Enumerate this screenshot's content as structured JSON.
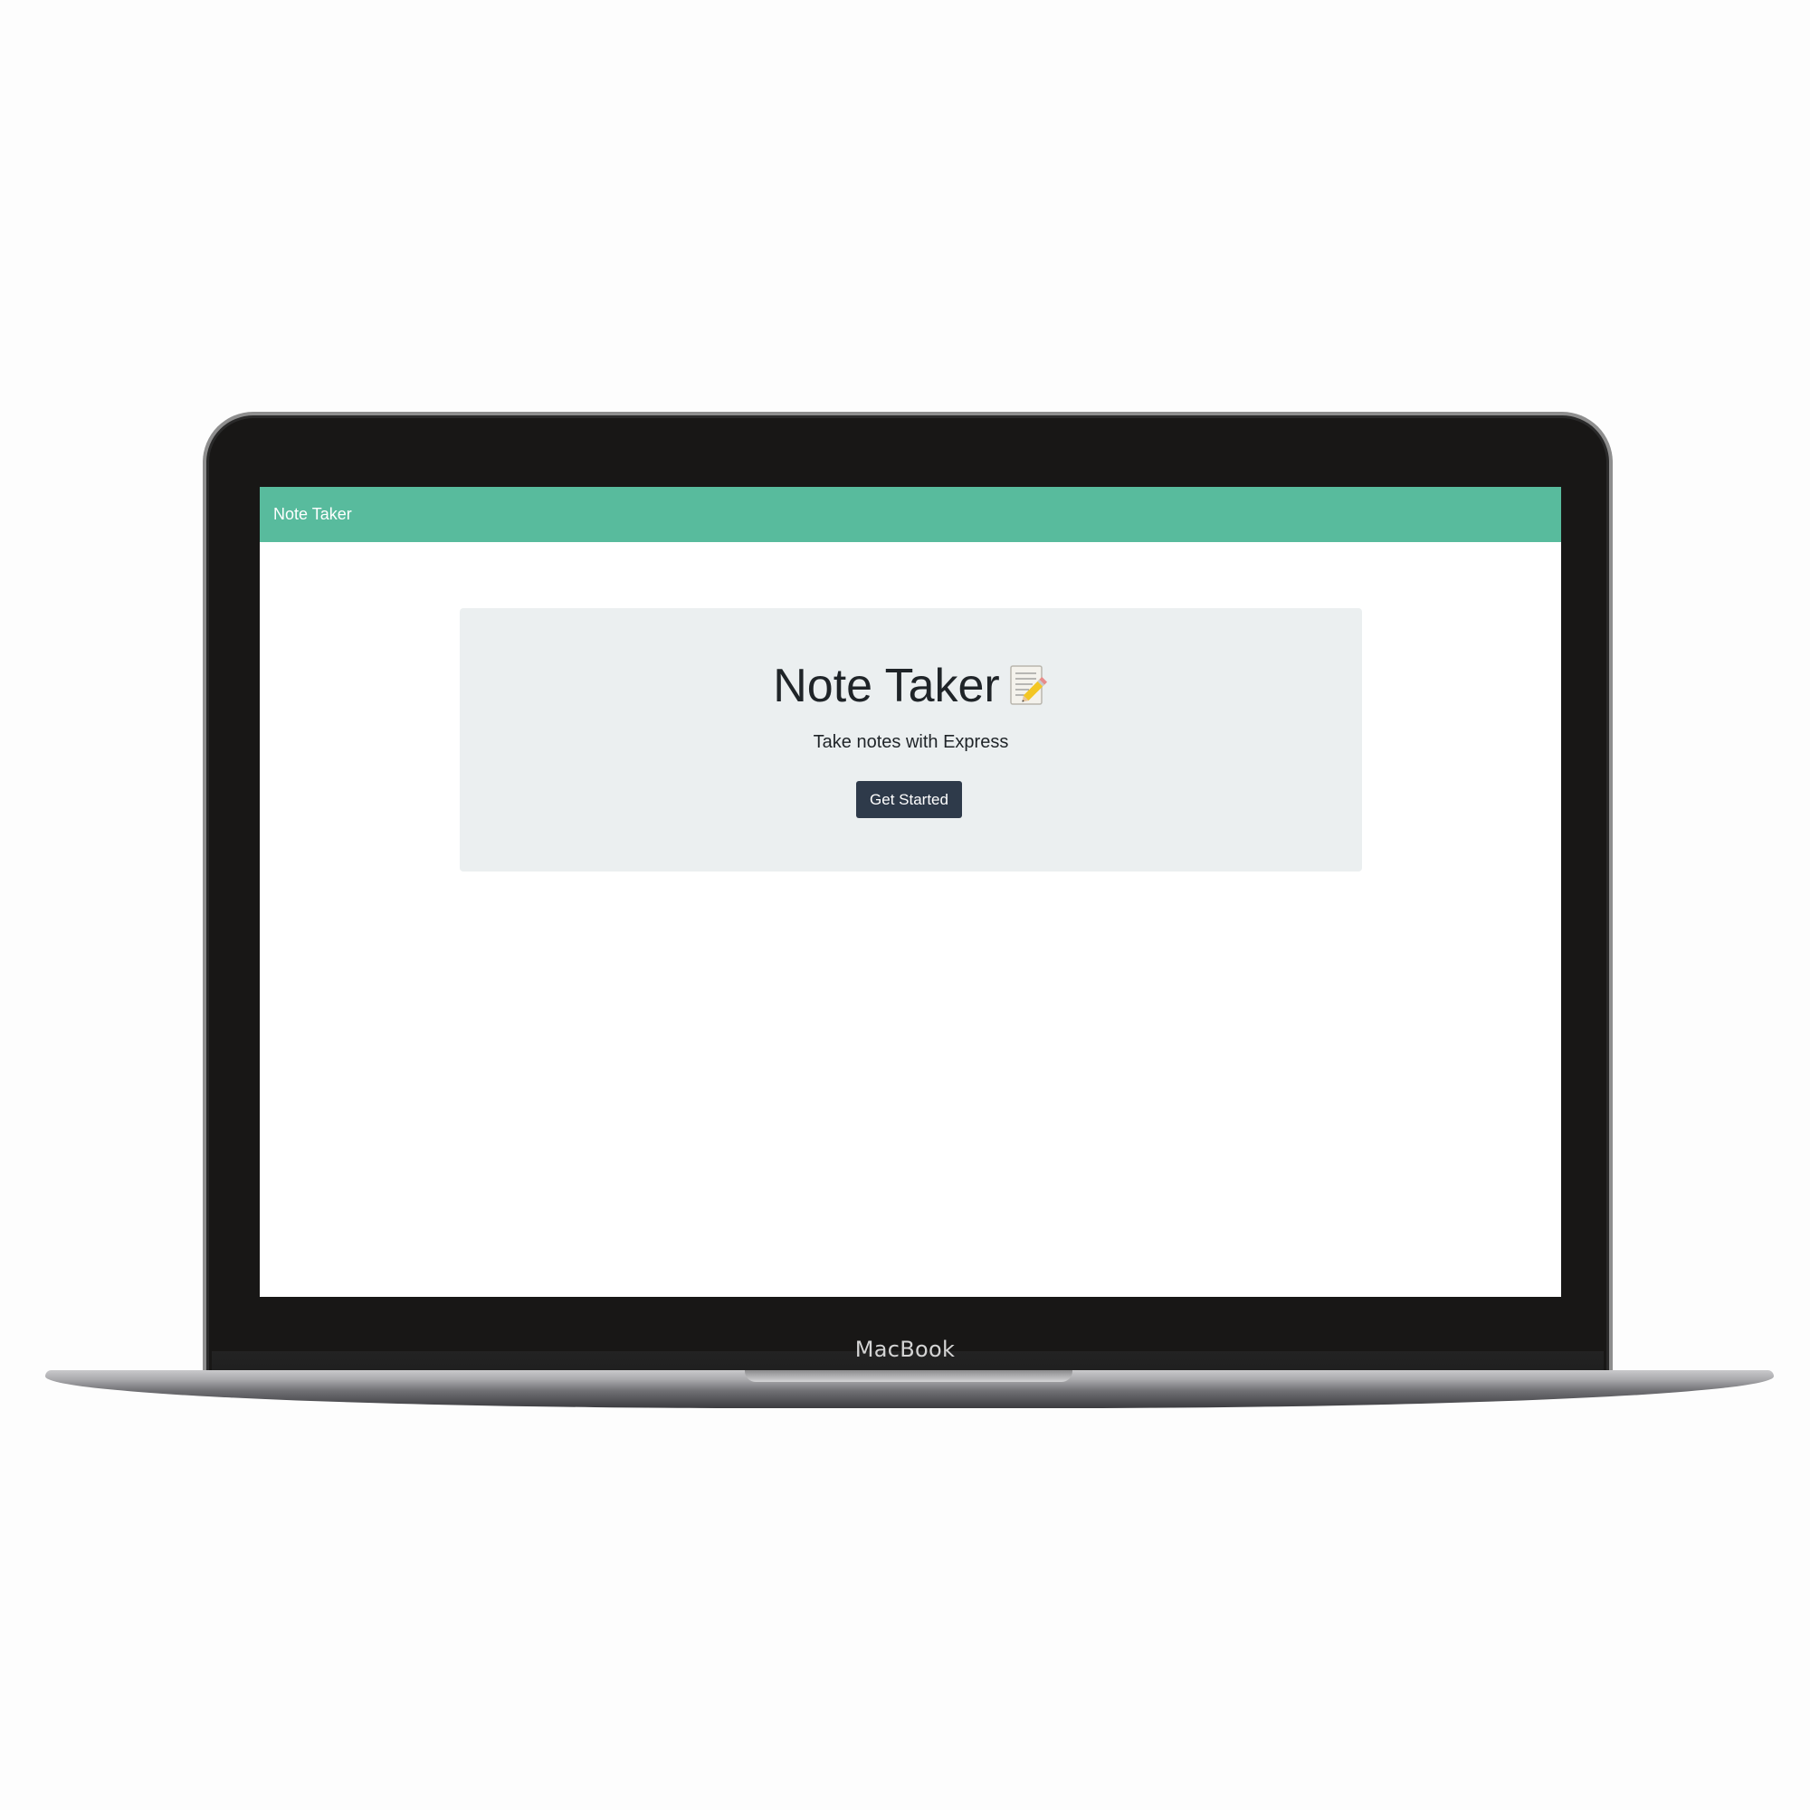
{
  "device": {
    "brand_label": "MacBook"
  },
  "navbar": {
    "brand": "Note Taker",
    "color": "#58bb9d"
  },
  "hero": {
    "title": "Note Taker",
    "title_icon": "memo-icon",
    "subtitle": "Take notes with Express",
    "button_label": "Get Started",
    "button_color": "#2e3a4a",
    "background": "#ebeff0"
  }
}
